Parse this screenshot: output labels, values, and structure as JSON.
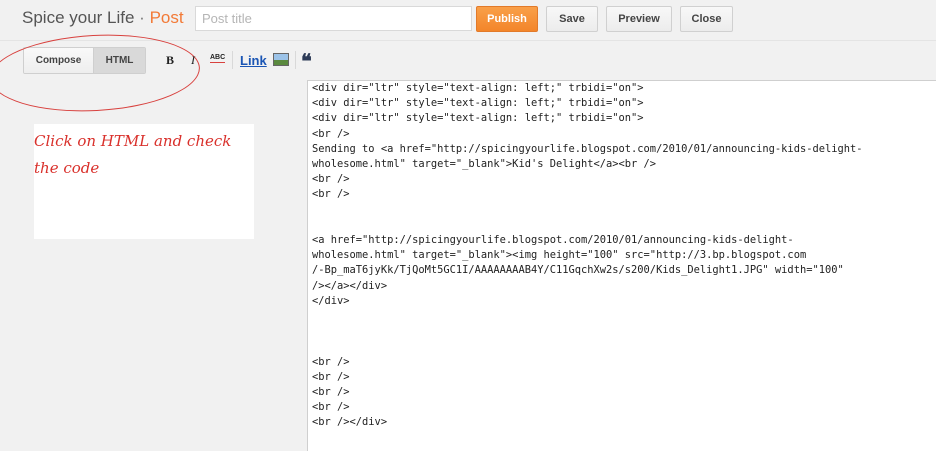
{
  "header": {
    "blog_name": "Spice your Life",
    "separator": " · ",
    "section": "Post",
    "title_placeholder": "Post title",
    "buttons": {
      "publish": "Publish",
      "save": "Save",
      "preview": "Preview",
      "close": "Close"
    },
    "accent_color": "#f27a37"
  },
  "mode_tabs": {
    "compose": "Compose",
    "html": "HTML",
    "active": "HTML"
  },
  "toolbar": {
    "bold": "B",
    "italic": "I",
    "spellcheck": "ABC",
    "link": "Link",
    "image_icon": "image-icon",
    "quote": "❝"
  },
  "annotation": {
    "text": "Click on HTML and check\nthe code",
    "color": "#d9302b"
  },
  "editor": {
    "lines": [
      "<div dir=\"ltr\" style=\"text-align: left;\" trbidi=\"on\">",
      "<div dir=\"ltr\" style=\"text-align: left;\" trbidi=\"on\">",
      "<div dir=\"ltr\" style=\"text-align: left;\" trbidi=\"on\">",
      "<br />",
      "Sending to <a href=\"http://spicingyourlife.blogspot.com/2010/01/announcing-kids-delight-",
      "wholesome.html\" target=\"_blank\">Kid's Delight</a><br />",
      "<br />",
      "<br />",
      "",
      "",
      "<a href=\"http://spicingyourlife.blogspot.com/2010/01/announcing-kids-delight-",
      "wholesome.html\" target=\"_blank\"><img height=\"100\" src=\"http://3.bp.blogspot.com",
      "/-Bp_maT6jyKk/TjQoMt5GC1I/AAAAAAAAB4Y/C11GqchXw2s/s200/Kids_Delight1.JPG\" width=\"100\"",
      "/></a></div>",
      "</div>",
      "",
      "",
      "",
      "<br />",
      "<br />",
      "<br />",
      "<br />",
      "<br /></div>"
    ]
  }
}
